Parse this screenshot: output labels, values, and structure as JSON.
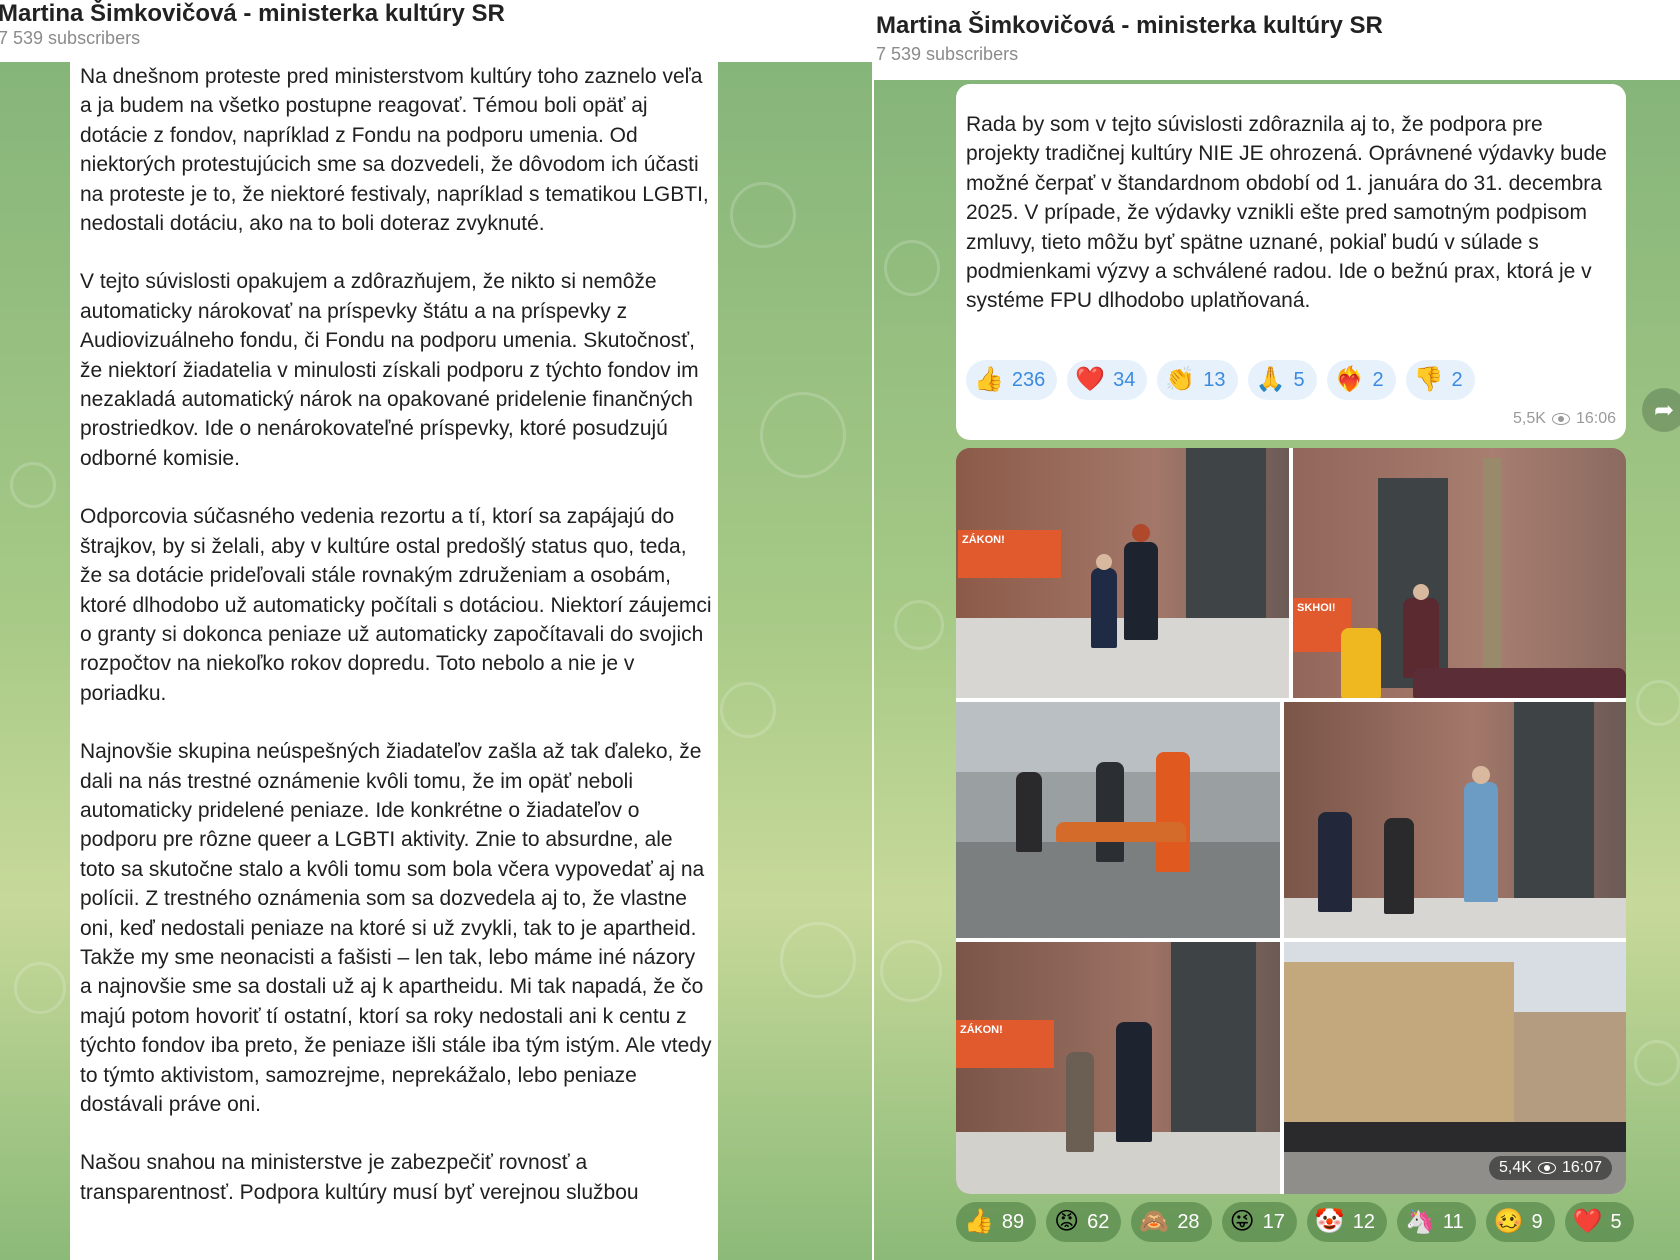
{
  "left": {
    "header": {
      "title": "Martina Šimkovičová - ministerka kultúry SR",
      "subscribers": "7 539 subscribers"
    },
    "paragraphs": [
      "Na dnešnom proteste pred ministerstvom kultúry toho zaznelo veľa a ja budem na všetko postupne reagovať. Témou boli opäť aj dotácie z fondov, napríklad z Fondu na podporu umenia. Od niektorých protestujúcich sme sa dozvedeli, že dôvodom ich účasti na proteste je to, že niektoré festivaly, napríklad s tematikou LGBTI, nedostali dotáciu, ako na to boli doteraz zvyknuté.",
      "V tejto súvislosti opakujem a zdôrazňujem, že nikto si nemôže automaticky nárokovať na príspevky štátu a na príspevky z Audiovizuálneho fondu, či Fondu na podporu umenia. Skutočnosť, že niektorí žiadatelia v minulosti získali podporu z týchto fondov im nezakladá automatický nárok na opakované pridelenie finančných prostriedkov. Ide o nenárokovateľné príspevky, ktoré posudzujú odborné komisie.",
      "Odporcovia súčasného vedenia rezortu a tí, ktorí sa zapájajú do štrajkov, by si želali, aby v kultúre ostal predošlý status quo, teda, že sa dotácie prideľovali stále rovnakým združeniam a osobám, ktoré dlhodobo už automaticky počítali s dotáciou. Niektorí záujemci o granty si dokonca peniaze už automaticky započítavali do svojich rozpočtov na niekoľko rokov dopredu. Toto nebolo a nie je v poriadku.",
      "Najnovšie skupina neúspešných žiadateľov zašla až tak ďaleko, že dali na nás trestné oznámenie kvôli tomu, že im opäť neboli automaticky pridelené peniaze. Ide konkrétne o žiadateľov o podporu pre rôzne queer a LGBTI aktivity. Znie to absurdne, ale toto sa skutočne stalo a kvôli tomu som bola včera vypovedať aj na polícii. Z trestného oznámenia som sa dozvedela aj to, že vlastne oni, keď nedostali peniaze na ktoré si už zvykli, tak to je apartheid. Takže my sme neonacisti a fašisti – len tak, lebo máme iné názory a najnovšie sme sa dostali už aj k apartheidu. Mi tak napadá, že čo majú potom hovoriť tí ostatní, ktorí sa roky nedostali ani k centu z týchto fondov iba preto, že peniaze išli stále iba tým istým. Ale vtedy to týmto aktivistom, samozrejme, neprekážalo, lebo peniaze dostávali práve oni.",
      "Našou snahou na ministerstve je zabezpečiť rovnosť a transparentnosť. Podpora kultúry musí byť verejnou službou"
    ]
  },
  "right": {
    "header": {
      "title": "Martina Šimkovičová - ministerka kultúry SR",
      "subscribers": "7 539 subscribers"
    },
    "message_text": "Rada by som v tejto súvislosti zdôraznila aj to, že podpora pre projekty tradičnej kultúry NIE JE ohrozená. Oprávnené výdavky bude možné čerpať v štandardnom období od 1. januára do 31. decembra 2025. V prípade, že výdavky vznikli ešte pred samotným podpisom zmluvy, tieto môžu byť spätne uznané, pokiaľ budú v súlade s podmienkami výzvy a schválené radou. Ide o bežnú prax, ktorá je v systéme FPU dlhodobo uplatňovaná.",
    "reactions": [
      {
        "icon": "thumbs-up-icon",
        "emoji": "👍",
        "count": "236"
      },
      {
        "icon": "heart-icon",
        "emoji": "❤️",
        "count": "34"
      },
      {
        "icon": "clap-icon",
        "emoji": "👏",
        "count": "13"
      },
      {
        "icon": "pray-icon",
        "emoji": "🙏",
        "count": "5"
      },
      {
        "icon": "heart-fire-icon",
        "emoji": "❤️‍🔥",
        "count": "2"
      },
      {
        "icon": "thumbs-down-icon",
        "emoji": "👎",
        "count": "2"
      }
    ],
    "views": "5,5K",
    "time": "16:06",
    "album_views": "5,4K",
    "album_time": "16:07",
    "album_reactions": [
      {
        "icon": "thumbs-up-icon",
        "emoji": "👍",
        "count": "89"
      },
      {
        "icon": "angry-face-icon",
        "emoji": "😡",
        "count": "62"
      },
      {
        "icon": "monkey-icon",
        "emoji": "🙈",
        "count": "28"
      },
      {
        "icon": "tongue-face-icon",
        "emoji": "😜",
        "count": "17"
      },
      {
        "icon": "clown-icon",
        "emoji": "🤡",
        "count": "12"
      },
      {
        "icon": "unicorn-icon",
        "emoji": "🦄",
        "count": "11"
      },
      {
        "icon": "woozy-face-icon",
        "emoji": "🥴",
        "count": "9"
      },
      {
        "icon": "heart-icon",
        "emoji": "❤️",
        "count": "5"
      }
    ],
    "banner_texts": [
      "SKHOI!",
      "ZÁKON!"
    ]
  },
  "colors": {
    "chat_green": "#9cc483",
    "bubble": "#ffffff",
    "reaction_blue": "#3a8ae0",
    "banner_orange": "#e05a2e"
  }
}
